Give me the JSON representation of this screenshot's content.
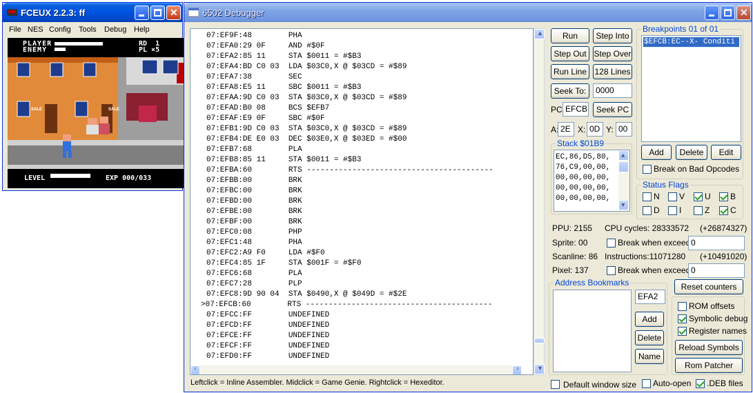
{
  "fceux": {
    "title": "FCEUX 2.2.3: ff",
    "menu": [
      "File",
      "NES",
      "Config",
      "Tools",
      "Debug",
      "Help"
    ],
    "game": {
      "player_label": "PLAYER",
      "enemy_label": "ENEMY",
      "rd": "RD  1",
      "pl": "PL ×5",
      "level_label": "LEVEL",
      "exp_label": "EXP 000/033",
      "sign1": "SALE",
      "sign2": "SALE"
    }
  },
  "debugger": {
    "title": "6502 Debugger",
    "disassembly": [
      "07:EF9F:48        PHA",
      "07:EFA0:29 0F     AND #$0F",
      "07:EFA2:85 11     STA $0011 = #$B3",
      "07:EFA4:BD C0 03  LDA $03C0,X @ $03CD = #$89",
      "07:EFA7:38        SEC",
      "07:EFA8:E5 11     SBC $0011 = #$B3",
      "07:EFAA:9D C0 03  STA $03C0,X @ $03CD = #$89",
      "07:EFAD:B0 08     BCS $EFB7",
      "07:EFAF:E9 0F     SBC #$0F",
      "07:EFB1:9D C0 03  STA $03C0,X @ $03CD = #$89",
      "07:EFB4:DE E0 03  DEC $03E0,X @ $03ED = #$00",
      "07:EFB7:68        PLA",
      "07:EFB8:85 11     STA $0011 = #$B3",
      "07:EFBA:60        RTS -----------------------------------------",
      "07:EFBB:00        BRK",
      "07:EFBC:00        BRK",
      "07:EFBD:00        BRK",
      "07:EFBE:00        BRK",
      "07:EFBF:00        BRK",
      "07:EFC0:08        PHP",
      "07:EFC1:48        PHA",
      "07:EFC2:A9 F0     LDA #$F0",
      "07:EFC4:85 1F     STA $001F = #$F0",
      "07:EFC6:68        PLA",
      "07:EFC7:28        PLP",
      "07:EFC8:9D 90 04  STA $0490,X @ $049D = #$2E",
      ">07:EFCB:60        RTS -----------------------------------------",
      "07:EFCC:FF        UNDEFINED",
      "07:EFCD:FF        UNDEFINED",
      "07:EFCE:FF        UNDEFINED",
      "07:EFCF:FF        UNDEFINED",
      "07:EFD0:FF        UNDEFINED"
    ],
    "buttons": {
      "run": "Run",
      "step_into": "Step Into",
      "step_out": "Step Out",
      "step_over": "Step Over",
      "run_line": "Run Line",
      "lines_128": "128 Lines",
      "seek_to": "Seek To:",
      "seek_pc": "Seek PC",
      "bp_add": "Add",
      "bp_delete": "Delete",
      "bp_edit": "Edit",
      "reset_counters": "Reset counters",
      "bm_add": "Add",
      "bm_delete": "Delete",
      "bm_name": "Name",
      "reload_symbols": "Reload Symbols",
      "rom_patcher": "Rom Patcher"
    },
    "seek_to_value": "0000",
    "pc_label": "PC:",
    "pc_value": "EFCB",
    "a_label": "A:",
    "a_value": "2E",
    "x_label": "X:",
    "x_value": "0D",
    "y_label": "Y:",
    "y_value": "00",
    "stack": {
      "title": "Stack $01B9",
      "lines": [
        "EC,86,D5,80,",
        "76,C9,00,00,",
        "00,00,00,00,",
        "00,00,00,00,",
        "00,00,00,00,"
      ]
    },
    "breakpoints": {
      "title": "Breakpoints 01 of 01",
      "items": [
        "$EFCB:EC--X- Conditi"
      ],
      "break_on_bad_opcodes": "Break on Bad Opcodes"
    },
    "status_flags": {
      "title": "Status Flags",
      "flags": [
        {
          "name": "N",
          "checked": false
        },
        {
          "name": "V",
          "checked": false
        },
        {
          "name": "U",
          "checked": true
        },
        {
          "name": "B",
          "checked": true
        },
        {
          "name": "D",
          "checked": false
        },
        {
          "name": "I",
          "checked": false
        },
        {
          "name": "Z",
          "checked": false
        },
        {
          "name": "C",
          "checked": true
        }
      ]
    },
    "ppu": "PPU: 2155",
    "sprite": "Sprite: 00",
    "scanline": "Scanline: 86",
    "pixel": "Pixel: 137",
    "cpu_cycles": "CPU cycles: 28333572",
    "cpu_cycles_delta": "(+26874327)",
    "break_when_exceed": "Break when exceed",
    "cycles_exceed_value": "0",
    "instructions": "Instructions:11071280",
    "instructions_delta": "(+10491020)",
    "instr_exceed_value": "0",
    "address_bookmarks": {
      "title": "Address Bookmarks",
      "input": "EFA2"
    },
    "options": {
      "rom_offsets": "ROM offsets",
      "symbolic_debug": "Symbolic debug",
      "register_names": "Register names"
    },
    "footer_hint": "Leftclick = Inline Assembler. Midclick = Game Genie. Rightclick = Hexeditor.",
    "default_window_size": "Default window size",
    "auto_open": "Auto-open",
    "deb_files": ".DEB files",
    "colors": {
      "title_blue": "#0054e3",
      "accent": "#0046d5",
      "selection": "#316ac5"
    }
  }
}
